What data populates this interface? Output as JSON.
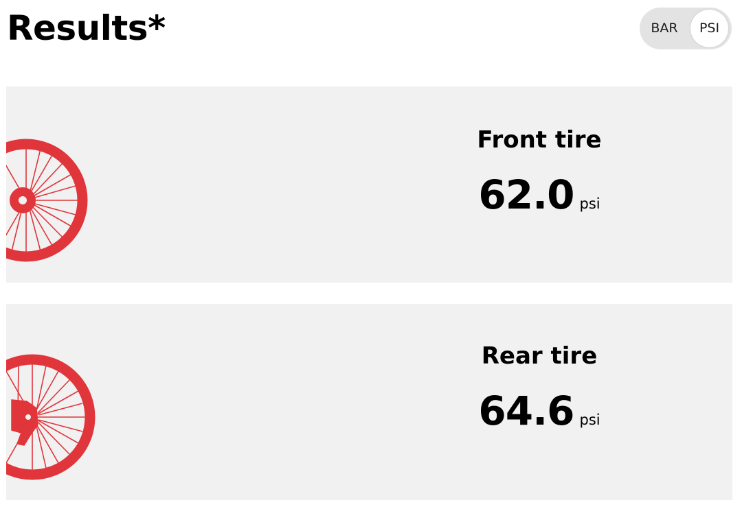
{
  "header": {
    "title": "Results*"
  },
  "unit_toggle": {
    "options": [
      "BAR",
      "PSI"
    ],
    "selected": "PSI"
  },
  "tires": [
    {
      "label": "Front tire",
      "value": "62.0",
      "unit": "psi",
      "icon": "front-wheel-icon"
    },
    {
      "label": "Rear tire",
      "value": "64.6",
      "unit": "psi",
      "icon": "rear-wheel-icon"
    }
  ],
  "colors": {
    "accent": "#e0353b",
    "card_background": "#f1f1f1",
    "toggle_track": "#e3e3e3"
  }
}
